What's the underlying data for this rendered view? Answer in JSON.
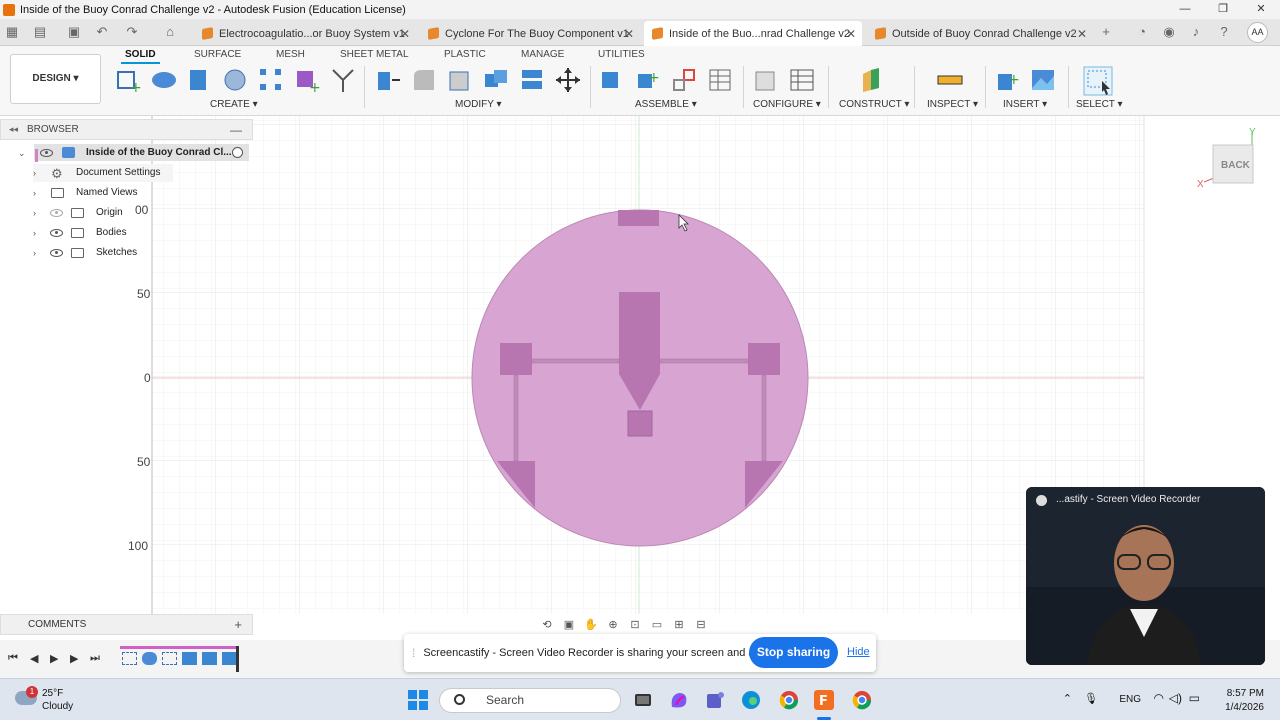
{
  "window": {
    "title": "Inside of the Buoy Conrad Challenge v2 - Autodesk Fusion (Education License)",
    "controls": [
      "—",
      "❐",
      "✕"
    ]
  },
  "doc_tabs": [
    {
      "label": "Electrocoagulatio...or Buoy System v1",
      "active": false
    },
    {
      "label": "Cyclone For The Buoy Component v1",
      "active": false
    },
    {
      "label": "Inside of the Buo...nrad Challenge v2",
      "active": true
    },
    {
      "label": "Outside of Buoy Conrad Challenge v2",
      "active": false
    }
  ],
  "user_initials": "AA",
  "ribbon": {
    "design_label": "DESIGN",
    "tabs": [
      "SOLID",
      "SURFACE",
      "MESH",
      "SHEET METAL",
      "PLASTIC",
      "MANAGE",
      "UTILITIES"
    ],
    "groups": [
      "CREATE",
      "MODIFY",
      "ASSEMBLE",
      "CONFIGURE",
      "CONSTRUCT",
      "INSPECT",
      "INSERT",
      "SELECT"
    ]
  },
  "browser": {
    "title": "BROWSER",
    "root": "Inside of the Buoy Conrad Cl...",
    "items": [
      "Document Settings",
      "Named Views",
      "Origin",
      "Bodies",
      "Sketches"
    ]
  },
  "comments_label": "COMMENTS",
  "viewcube_label": "BACK",
  "axis_ticks": [
    "00",
    "50",
    "0",
    "50",
    "100"
  ],
  "axis_letters": {
    "x": "X",
    "y": "Y"
  },
  "share_bar": {
    "message": "Screencastify - Screen Video Recorder is sharing your screen and audio.",
    "stop_label": "Stop sharing",
    "hide_label": "Hide"
  },
  "recorder_title": "...astify - Screen Video Recorder",
  "taskbar": {
    "weather_temp": "25°F",
    "weather_cond": "Cloudy",
    "weather_badge": "1",
    "search_placeholder": "Search",
    "language": "ENG",
    "time": "8:57 PM",
    "date": "1/4/2026"
  },
  "colors": {
    "body_fill": "#d8a4d2",
    "feature_fill": "#b876b0",
    "accent": "#0696d7",
    "share_button": "#1a73e8"
  }
}
